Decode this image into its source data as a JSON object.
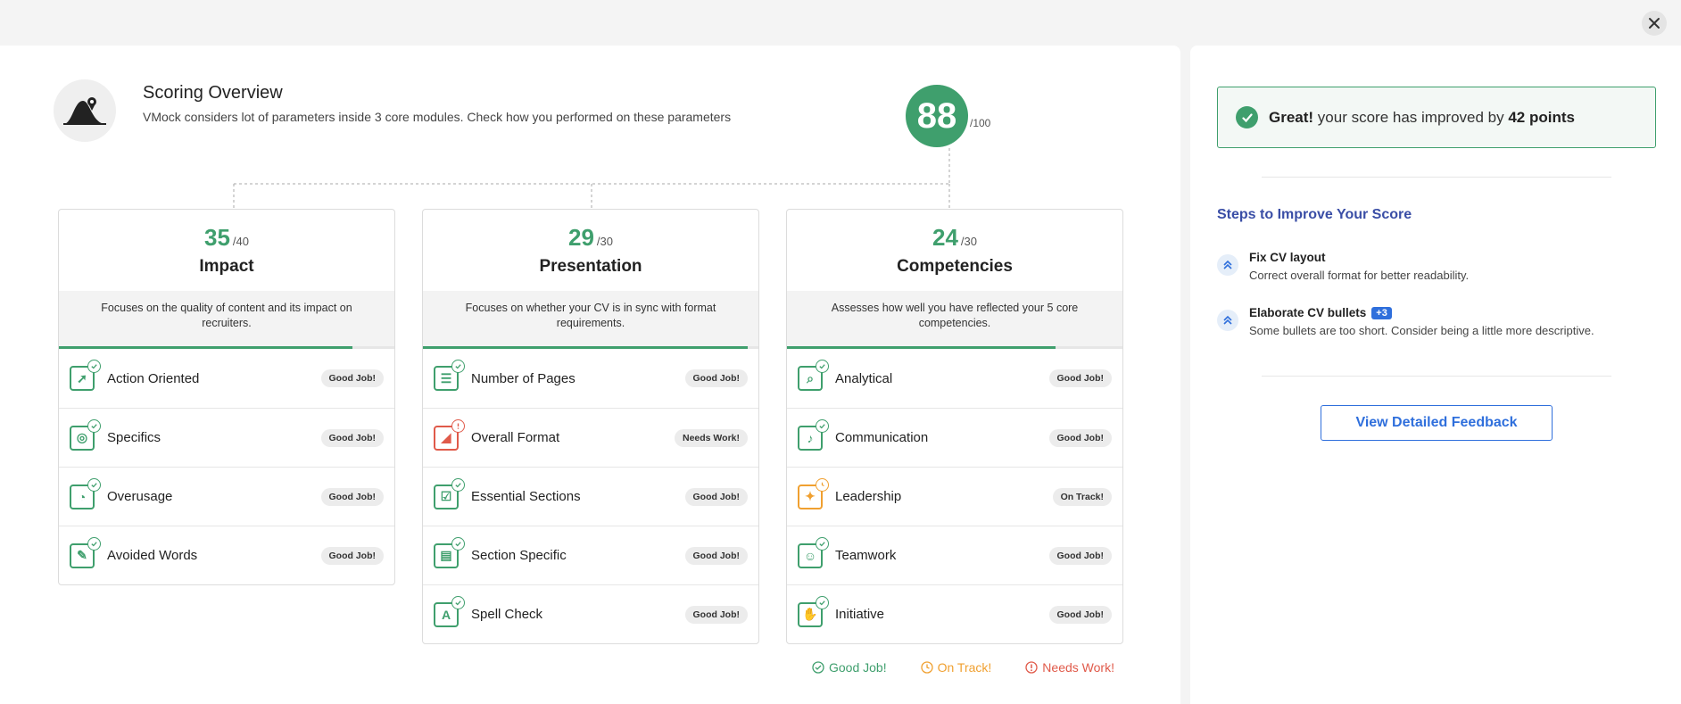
{
  "overview": {
    "title": "Scoring Overview",
    "description": "VMock considers lot of parameters inside 3 core modules. Check how you performed on these parameters",
    "total_score": "88",
    "total_max": "/100"
  },
  "modules": [
    {
      "score": "35",
      "max": "/40",
      "name": "Impact",
      "description": "Focuses on the quality of content and its impact on recruiters.",
      "progress": 0.875,
      "items": [
        {
          "label": "Action Oriented",
          "status": "Good Job!"
        },
        {
          "label": "Specifics",
          "status": "Good Job!"
        },
        {
          "label": "Overusage",
          "status": "Good Job!"
        },
        {
          "label": "Avoided Words",
          "status": "Good Job!"
        }
      ]
    },
    {
      "score": "29",
      "max": "/30",
      "name": "Presentation",
      "description": "Focuses on whether your CV is in sync with format requirements.",
      "progress": 0.967,
      "items": [
        {
          "label": "Number of Pages",
          "status": "Good Job!"
        },
        {
          "label": "Overall Format",
          "status": "Needs Work!"
        },
        {
          "label": "Essential Sections",
          "status": "Good Job!"
        },
        {
          "label": "Section Specific",
          "status": "Good Job!"
        },
        {
          "label": "Spell Check",
          "status": "Good Job!"
        }
      ]
    },
    {
      "score": "24",
      "max": "/30",
      "name": "Competencies",
      "description": "Assesses how well you have reflected your 5 core competencies.",
      "progress": 0.8,
      "items": [
        {
          "label": "Analytical",
          "status": "Good Job!"
        },
        {
          "label": "Communication",
          "status": "Good Job!"
        },
        {
          "label": "Leadership",
          "status": "On Track!"
        },
        {
          "label": "Teamwork",
          "status": "Good Job!"
        },
        {
          "label": "Initiative",
          "status": "Good Job!"
        }
      ]
    }
  ],
  "legend": {
    "good": "Good Job!",
    "on_track": "On Track!",
    "needs_work": "Needs Work!"
  },
  "right": {
    "alert_prefix": "Great!",
    "alert_middle": " your score has improved by ",
    "alert_points": "42 points",
    "steps_title": "Steps to Improve Your Score",
    "steps": [
      {
        "title": "Fix CV layout",
        "desc": "Correct overall format for better readability."
      },
      {
        "title": "Elaborate CV bullets",
        "badge": "+3",
        "desc": "Some bullets are too short. Consider being a little more descriptive."
      }
    ],
    "button_label": "View Detailed Feedback"
  },
  "colors": {
    "good": "#3f9f6d",
    "on_track": "#f0a030",
    "needs_work": "#e05a4a",
    "link": "#2f6fdc"
  }
}
